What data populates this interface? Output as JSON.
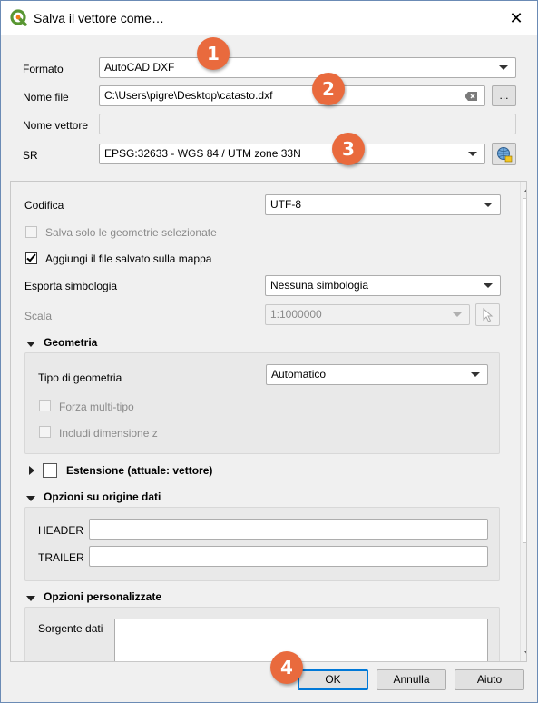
{
  "window": {
    "title": "Salva il vettore come…",
    "close_glyph": "✕"
  },
  "form": {
    "formato": {
      "label": "Formato",
      "value": "AutoCAD DXF"
    },
    "nome_file": {
      "label": "Nome file",
      "value": "C:\\Users\\pigre\\Desktop\\catasto.dxf",
      "browse_label": "..."
    },
    "nome_vettore": {
      "label": "Nome vettore",
      "value": ""
    },
    "sr": {
      "label": "SR",
      "value": "EPSG:32633 - WGS 84 / UTM zone 33N"
    }
  },
  "options": {
    "codifica": {
      "label": "Codifica",
      "value": "UTF-8"
    },
    "salva_solo": {
      "label": "Salva solo le geometrie selezionate",
      "checked": false,
      "enabled": false
    },
    "aggiungi": {
      "label": "Aggiungi il file salvato sulla mappa",
      "checked": true,
      "enabled": true
    },
    "esporta_simbologia": {
      "label": "Esporta simbologia",
      "value": "Nessuna simbologia"
    },
    "scala": {
      "label": "Scala",
      "value": "1:1000000",
      "enabled": false
    }
  },
  "geometria": {
    "title": "Geometria",
    "expanded": true,
    "tipo": {
      "label": "Tipo di geometria",
      "value": "Automatico"
    },
    "forza_multi": {
      "label": "Forza multi-tipo",
      "checked": false,
      "enabled": false
    },
    "includi_z": {
      "label": "Includi dimensione z",
      "checked": false,
      "enabled": false
    }
  },
  "estensione": {
    "title": "Estensione (attuale: vettore)",
    "expanded": false,
    "checked": false
  },
  "origine_dati": {
    "title": "Opzioni su origine dati",
    "expanded": true,
    "header": {
      "label": "HEADER",
      "value": ""
    },
    "trailer": {
      "label": "TRAILER",
      "value": ""
    }
  },
  "personalizzate": {
    "title": "Opzioni personalizzate",
    "expanded": true,
    "sorgente": {
      "label": "Sorgente dati",
      "value": ""
    }
  },
  "buttons": {
    "ok": "OK",
    "annulla": "Annulla",
    "aiuto": "Aiuto"
  },
  "badges": [
    "1",
    "2",
    "3",
    "4"
  ],
  "colors": {
    "badge": "#e96a3d",
    "accent": "#0078d7",
    "qgis_green": "#589632"
  }
}
